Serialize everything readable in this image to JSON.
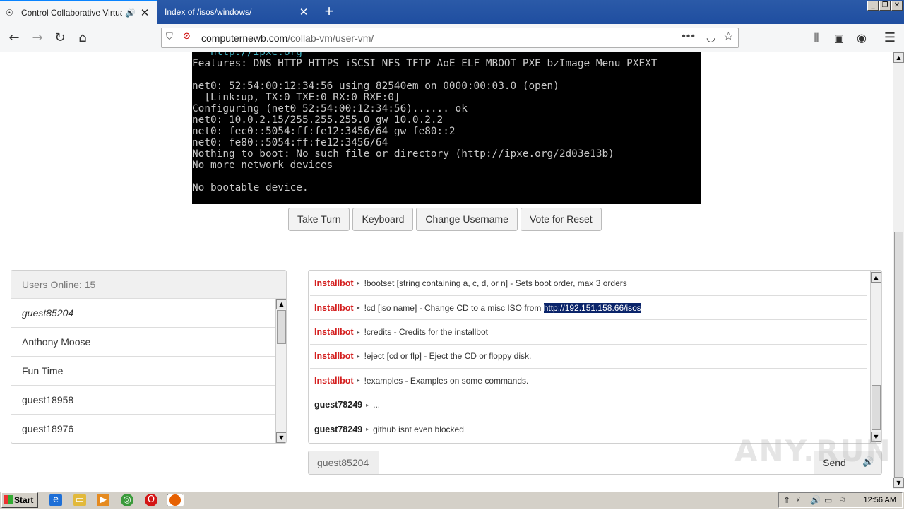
{
  "browser": {
    "tabs": [
      {
        "title": "Control Collaborative Virtual M",
        "close": "✕"
      },
      {
        "title": "Index of /isos/windows/",
        "close": "✕"
      }
    ],
    "new_tab": "+",
    "url_host": "computernewb.com",
    "url_path": "/collab-vm/user-vm/"
  },
  "vm": {
    "lines": [
      "   http://ipxe.org",
      "Features: DNS HTTP HTTPS iSCSI NFS TFTP AoE ELF MBOOT PXE bzImage Menu PXEXT",
      "",
      "net0: 52:54:00:12:34:56 using 82540em on 0000:00:03.0 (open)",
      "  [Link:up, TX:0 TXE:0 RX:0 RXE:0]",
      "Configuring (net0 52:54:00:12:34:56)...... ok",
      "net0: 10.0.2.15/255.255.255.0 gw 10.0.2.2",
      "net0: fec0::5054:ff:fe12:3456/64 gw fe80::2",
      "net0: fe80::5054:ff:fe12:3456/64",
      "Nothing to boot: No such file or directory (http://ipxe.org/2d03e13b)",
      "No more network devices",
      "",
      "No bootable device."
    ],
    "buttons": {
      "take_turn": "Take Turn",
      "keyboard": "Keyboard",
      "change_username": "Change Username",
      "vote_reset": "Vote for Reset"
    }
  },
  "users": {
    "header": "Users Online: 15",
    "list": [
      "guest85204",
      "Anthony Moose",
      "Fun Time",
      "guest18958",
      "guest18976"
    ]
  },
  "chat": {
    "messages": [
      {
        "user": "Installbot",
        "bot": true,
        "text": "!bootset [string containing a, c, d, or n] - Sets boot order, max 3 orders",
        "link": ""
      },
      {
        "user": "Installbot",
        "bot": true,
        "text": "!cd [iso name] - Change CD to a misc ISO from",
        "link": "http://192.151.158.66/isos"
      },
      {
        "user": "Installbot",
        "bot": true,
        "text": "!credits - Credits for the installbot",
        "link": ""
      },
      {
        "user": "Installbot",
        "bot": true,
        "text": "!eject [cd or flp] - Eject the CD or floppy disk.",
        "link": ""
      },
      {
        "user": "Installbot",
        "bot": true,
        "text": "!examples - Examples on some commands.",
        "link": ""
      },
      {
        "user": "guest78249",
        "bot": false,
        "text": "...",
        "link": ""
      },
      {
        "user": "guest78249",
        "bot": false,
        "text": "github isnt even blocked",
        "link": ""
      }
    ],
    "separator": "▸",
    "username": "guest85204",
    "input_value": "",
    "send_label": "Send"
  },
  "watermark": "ANY.RUN",
  "taskbar": {
    "start_label": "Start",
    "clock": "12:56 AM"
  }
}
